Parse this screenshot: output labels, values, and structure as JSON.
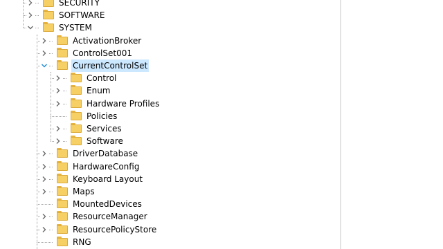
{
  "tree": {
    "nodes": [
      {
        "label": "SECURITY",
        "level": 0,
        "expander": "collapsed",
        "selected": false
      },
      {
        "label": "SOFTWARE",
        "level": 0,
        "expander": "collapsed",
        "selected": false
      },
      {
        "label": "SYSTEM",
        "level": 0,
        "expander": "expanded",
        "selected": false
      },
      {
        "label": "ActivationBroker",
        "level": 1,
        "expander": "collapsed",
        "selected": false
      },
      {
        "label": "ControlSet001",
        "level": 1,
        "expander": "collapsed",
        "selected": false
      },
      {
        "label": "CurrentControlSet",
        "level": 1,
        "expander": "expanded",
        "selected": true
      },
      {
        "label": "Control",
        "level": 2,
        "expander": "collapsed",
        "selected": false
      },
      {
        "label": "Enum",
        "level": 2,
        "expander": "collapsed",
        "selected": false
      },
      {
        "label": "Hardware Profiles",
        "level": 2,
        "expander": "collapsed",
        "selected": false
      },
      {
        "label": "Policies",
        "level": 2,
        "expander": "none",
        "selected": false
      },
      {
        "label": "Services",
        "level": 2,
        "expander": "collapsed",
        "selected": false
      },
      {
        "label": "Software",
        "level": 2,
        "expander": "collapsed",
        "selected": false
      },
      {
        "label": "DriverDatabase",
        "level": 1,
        "expander": "collapsed",
        "selected": false
      },
      {
        "label": "HardwareConfig",
        "level": 1,
        "expander": "collapsed",
        "selected": false
      },
      {
        "label": "Keyboard Layout",
        "level": 1,
        "expander": "collapsed",
        "selected": false
      },
      {
        "label": "Maps",
        "level": 1,
        "expander": "collapsed",
        "selected": false
      },
      {
        "label": "MountedDevices",
        "level": 1,
        "expander": "none",
        "selected": false
      },
      {
        "label": "ResourceManager",
        "level": 1,
        "expander": "collapsed",
        "selected": false
      },
      {
        "label": "ResourcePolicyStore",
        "level": 1,
        "expander": "collapsed",
        "selected": false
      },
      {
        "label": "RNG",
        "level": 1,
        "expander": "none",
        "selected": false
      }
    ]
  },
  "icons": {
    "folder": "folder-icon",
    "expand": "chevron-right-icon",
    "collapse": "chevron-down-icon"
  },
  "colors": {
    "selection": "#cce8ff",
    "folder_fill": "#f6d065",
    "folder_edge": "#dcab3c",
    "chevron": "#6b6b6b",
    "chevron_active": "#1a8ad4"
  }
}
